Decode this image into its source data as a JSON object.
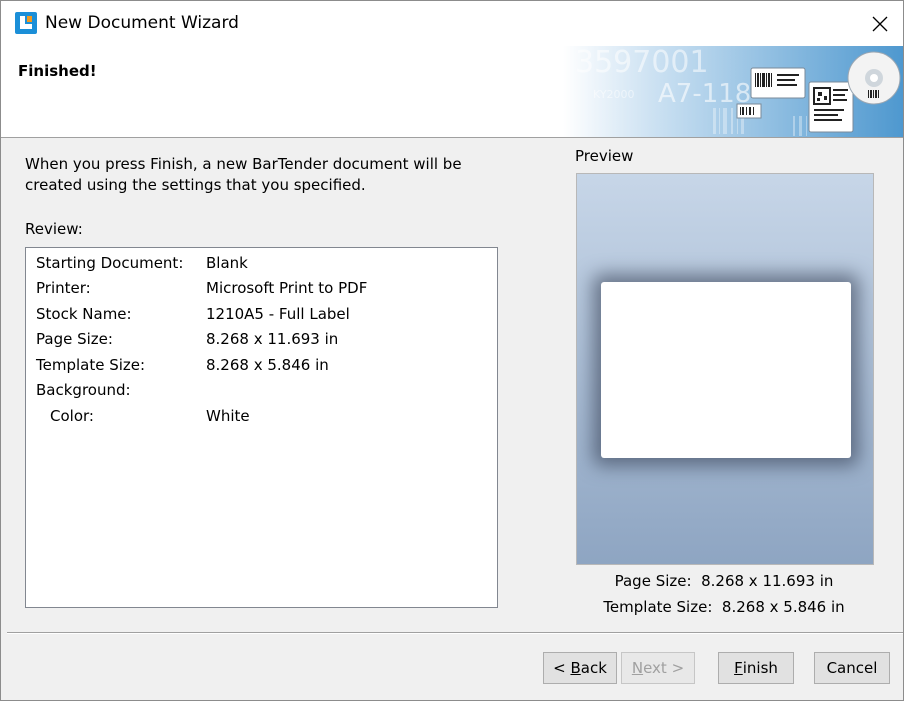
{
  "window": {
    "title": "New Document Wizard",
    "close_label": "✕"
  },
  "header": {
    "title": "Finished!",
    "banner_text_1": "3597001",
    "banner_text_2": "A7-118",
    "banner_text_3": "KY2000"
  },
  "intro_text": "When you press Finish, a new BarTender document will be created using the settings that you specified.",
  "review": {
    "label": "Review:",
    "rows": [
      {
        "key": "Starting Document:",
        "value": "Blank"
      },
      {
        "key": "Printer:",
        "value": "Microsoft Print to PDF"
      },
      {
        "key": "Stock Name:",
        "value": "1210A5 - Full Label"
      },
      {
        "key": "Page Size:",
        "value": "8.268 x 11.693 in"
      },
      {
        "key": "Template Size:",
        "value": "8.268 x 5.846 in"
      },
      {
        "key": "Background:",
        "value": ""
      },
      {
        "key": "Color:",
        "value": "White"
      }
    ]
  },
  "preview": {
    "label": "Preview",
    "page_size_label": "Page Size:",
    "page_size_value": "8.268 x 11.693 in",
    "template_size_label": "Template Size:",
    "template_size_value": "8.268 x 5.846 in"
  },
  "buttons": {
    "back_prefix": "< ",
    "back_hotkey": "B",
    "back_rest": "ack",
    "next_hotkey": "N",
    "next_rest": "ext >",
    "finish_hotkey": "F",
    "finish_rest": "inish",
    "cancel": "Cancel"
  },
  "colors": {
    "icon_blue": "#1b8fd8",
    "icon_orange": "#f39a1e",
    "preview_top": "#c7d6e8",
    "preview_bottom": "#8ea5c2"
  }
}
